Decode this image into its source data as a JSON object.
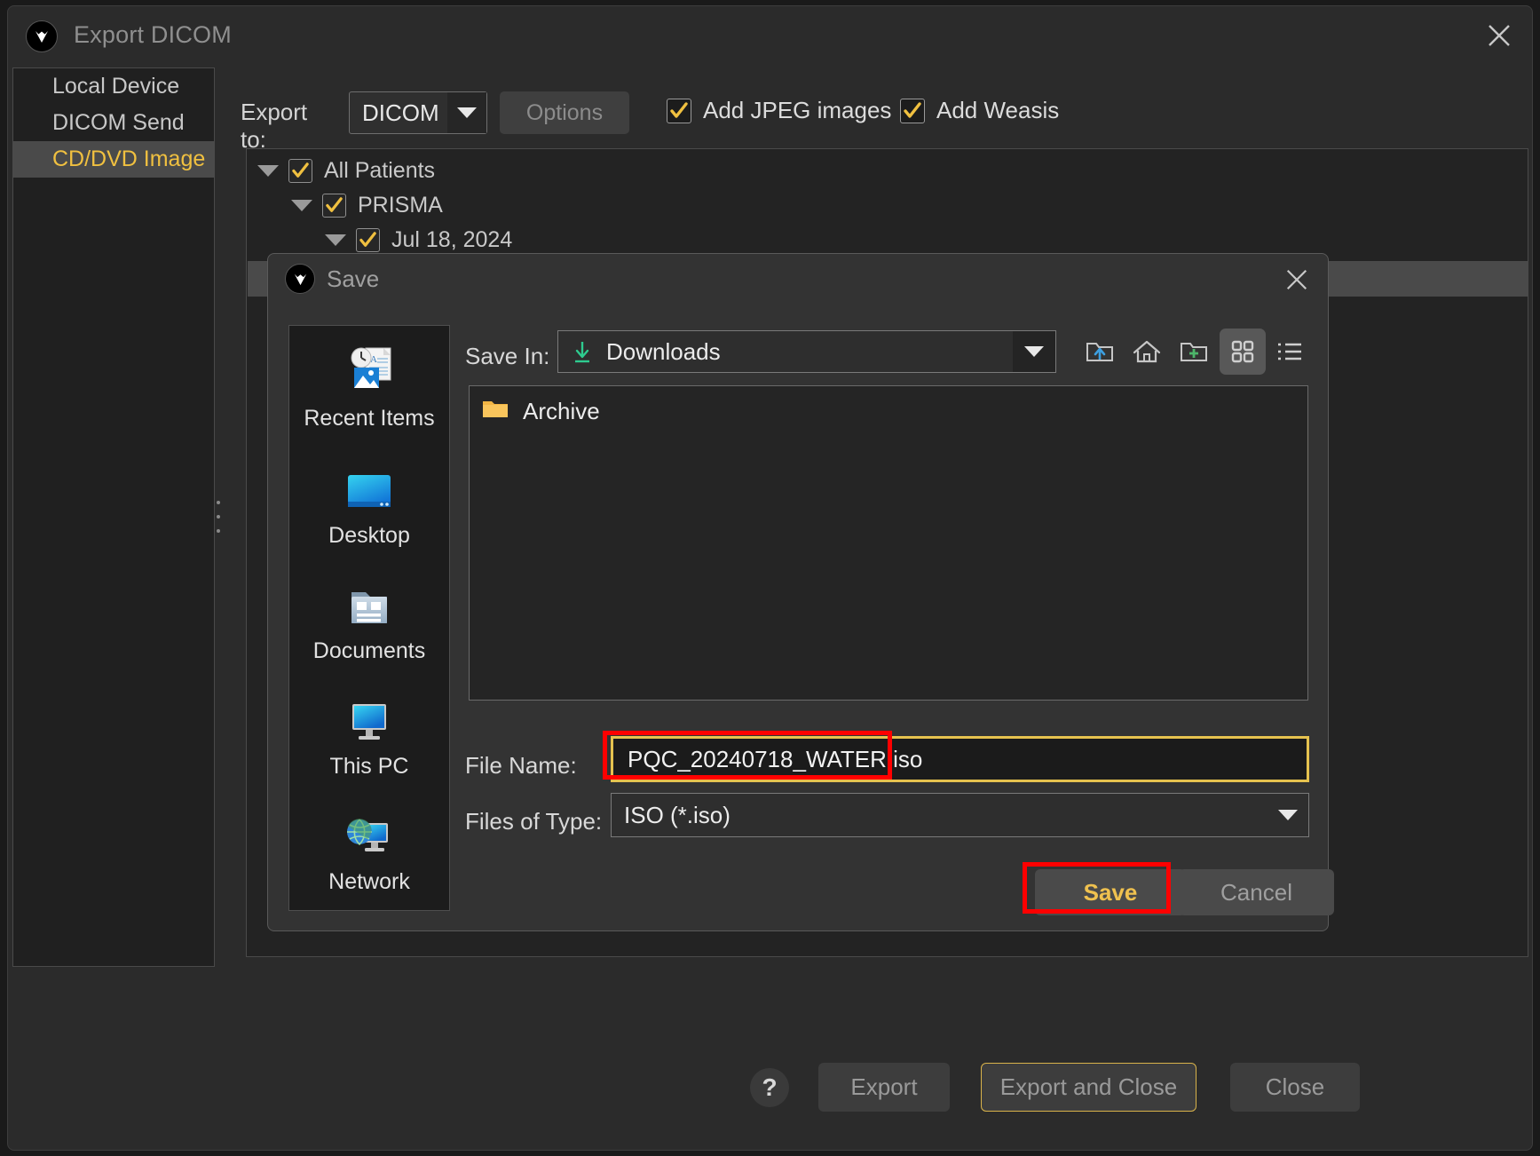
{
  "window": {
    "title": "Export DICOM",
    "logo_icon": "weasis-logo-icon",
    "close_icon": "close-icon"
  },
  "sidebar": {
    "items": [
      {
        "label": "Local Device",
        "selected": false
      },
      {
        "label": "DICOM Send",
        "selected": false
      },
      {
        "label": "CD/DVD Image",
        "selected": true
      }
    ]
  },
  "toolbar": {
    "export_to_label": "Export to:",
    "format_value": "DICOM",
    "format_caret_icon": "chevron-down-icon",
    "options_label": "Options",
    "checkboxes": [
      {
        "label": "Add JPEG images",
        "checked": true
      },
      {
        "label": "Add Weasis",
        "checked": true
      }
    ]
  },
  "tree": {
    "rows": [
      {
        "label": "All Patients",
        "checked": true,
        "expanded": true
      },
      {
        "label": "PRISMA",
        "checked": true,
        "expanded": true
      },
      {
        "label": "Jul 18, 2024",
        "checked": true,
        "expanded": true
      }
    ]
  },
  "footer": {
    "help_label": "?",
    "export_label": "Export",
    "export_and_close_label": "Export and Close",
    "close_label": "Close"
  },
  "save_dialog": {
    "title": "Save",
    "logo_icon": "weasis-logo-icon",
    "close_icon": "close-icon",
    "shortcuts": [
      {
        "label": "Recent Items",
        "icon": "recent-items-icon"
      },
      {
        "label": "Desktop",
        "icon": "desktop-icon"
      },
      {
        "label": "Documents",
        "icon": "documents-folder-icon"
      },
      {
        "label": "This PC",
        "icon": "this-pc-monitor-icon"
      },
      {
        "label": "Network",
        "icon": "network-globe-icon"
      }
    ],
    "save_in_label": "Save In:",
    "save_in_value": "Downloads",
    "save_in_icon": "download-arrow-icon",
    "toolbar_icons": [
      {
        "name": "up-one-level-icon",
        "selected": false
      },
      {
        "name": "home-icon",
        "selected": false
      },
      {
        "name": "new-folder-icon",
        "selected": false
      },
      {
        "name": "grid-view-icon",
        "selected": true
      },
      {
        "name": "list-view-icon",
        "selected": false
      }
    ],
    "files": [
      {
        "name": "Archive",
        "icon": "folder-icon"
      }
    ],
    "file_name_label": "File Name:",
    "file_name_value": "PQC_20240718_WATER.iso",
    "files_of_type_label": "Files of Type:",
    "files_of_type_value": "ISO (*.iso)",
    "save_label": "Save",
    "cancel_label": "Cancel"
  },
  "colors": {
    "accent_gold": "#efc14f",
    "annotation_red": "#ff0000",
    "folder_yellow": "#f2b544",
    "download_green": "#2ecb8f"
  }
}
